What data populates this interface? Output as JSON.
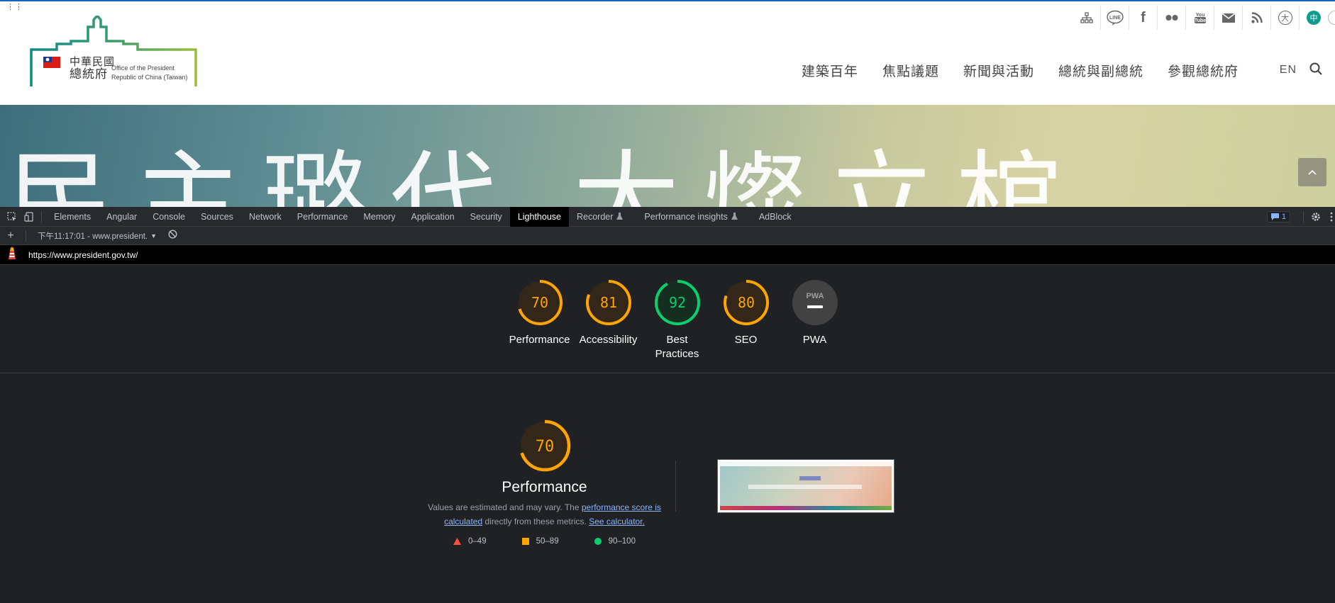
{
  "site": {
    "logo": {
      "chinese_line1": "中華民國",
      "chinese_line2": "總統府",
      "english_line1": "Office of the President",
      "english_line2": "Republic of China (Taiwan)"
    },
    "utility_icons": [
      "sitemap-icon",
      "line-icon",
      "facebook-icon",
      "flickr-icon",
      "youtube-icon",
      "mail-icon",
      "rss-icon",
      "font-size-icon",
      "chinese-language-icon"
    ],
    "utility_chinese_badge": "中",
    "utility_font_badge": "大",
    "nav": [
      "建築百年",
      "焦點議題",
      "新聞與活動",
      "總統與副總統",
      "參觀總統府"
    ],
    "lang": "EN",
    "hero_text": "民主璐代 大燦立棺"
  },
  "devtools": {
    "tabs": [
      "Elements",
      "Angular",
      "Console",
      "Sources",
      "Network",
      "Performance",
      "Memory",
      "Application",
      "Security",
      "Lighthouse",
      "Recorder",
      "Performance insights",
      "AdBlock"
    ],
    "active_tab": "Lighthouse",
    "issues_count": "1",
    "report_selector": "下午11:17:01 - www.president.",
    "url": "https://www.president.gov.tw/",
    "categories": [
      {
        "label": "Performance",
        "score": "70",
        "value": 70,
        "color": "#ffa400"
      },
      {
        "label": "Accessibility",
        "score": "81",
        "value": 81,
        "color": "#ffa400"
      },
      {
        "label": "Best Practices",
        "score": "92",
        "value": 92,
        "color": "#0cce6b"
      },
      {
        "label": "SEO",
        "score": "80",
        "value": 80,
        "color": "#ffa400"
      },
      {
        "label": "PWA",
        "score": "",
        "value": null,
        "color": "#9aa0a6"
      }
    ],
    "pwa_badge": "PWA",
    "performance": {
      "score": "70",
      "value": 70,
      "title": "Performance",
      "note_prefix": "Values are estimated and may vary. The ",
      "note_link1": "performance score is calculated",
      "note_middle": " directly from these metrics. ",
      "note_link2": "See calculator.",
      "legend": [
        {
          "range": "0–49",
          "shape": "triangle",
          "color": "#ff4e42"
        },
        {
          "range": "50–89",
          "shape": "square",
          "color": "#ffa400"
        },
        {
          "range": "90–100",
          "shape": "circle",
          "color": "#0cce6b"
        }
      ]
    }
  }
}
